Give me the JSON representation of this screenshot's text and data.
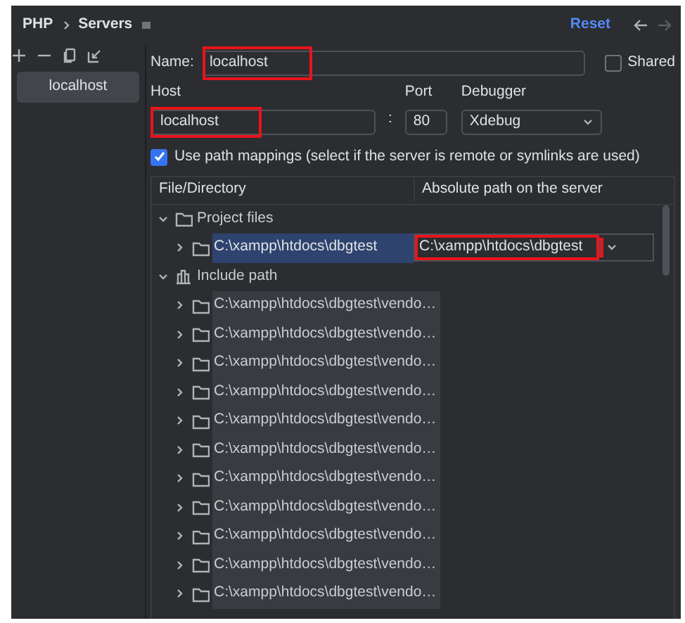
{
  "breadcrumb": [
    "PHP",
    "Servers"
  ],
  "header_actions": {
    "reset": "Reset"
  },
  "servers": [
    {
      "name": "localhost",
      "selected": true
    }
  ],
  "name_field": {
    "label": "Name:",
    "value": "localhost",
    "highlighted": true
  },
  "shared": {
    "label": "Shared",
    "checked": false
  },
  "host": {
    "label": "Host",
    "value": "localhost",
    "highlighted": true
  },
  "port_separator": ":",
  "port": {
    "label": "Port",
    "value": "80"
  },
  "debugger": {
    "label": "Debugger",
    "value": "Xdebug"
  },
  "use_path_mappings": {
    "label": "Use path mappings (select if the server is remote or symlinks are used)",
    "checked": true
  },
  "mappings": {
    "columns": [
      "File/Directory",
      "Absolute path on the server"
    ],
    "tree": [
      {
        "kind": "folder",
        "label": "Project files",
        "expanded": true,
        "children": [
          {
            "kind": "folder",
            "label": "C:\\xampp\\htdocs\\dbgtest",
            "expanded": false,
            "selected": true,
            "server_path": "C:\\xampp\\htdocs\\dbgtest",
            "highlighted": true
          }
        ]
      },
      {
        "kind": "library",
        "label": "Include path",
        "expanded": true,
        "children": [
          {
            "kind": "folder",
            "label": "C:\\xampp\\htdocs\\dbgtest\\vendo…",
            "expanded": false,
            "selected": false
          },
          {
            "kind": "folder",
            "label": "C:\\xampp\\htdocs\\dbgtest\\vendo…",
            "expanded": false,
            "selected": false
          },
          {
            "kind": "folder",
            "label": "C:\\xampp\\htdocs\\dbgtest\\vendo…",
            "expanded": false,
            "selected": false
          },
          {
            "kind": "folder",
            "label": "C:\\xampp\\htdocs\\dbgtest\\vendo…",
            "expanded": false,
            "selected": false
          },
          {
            "kind": "folder",
            "label": "C:\\xampp\\htdocs\\dbgtest\\vendo…",
            "expanded": false,
            "selected": false
          },
          {
            "kind": "folder",
            "label": "C:\\xampp\\htdocs\\dbgtest\\vendo…",
            "expanded": false,
            "selected": false
          },
          {
            "kind": "folder",
            "label": "C:\\xampp\\htdocs\\dbgtest\\vendo…",
            "expanded": false,
            "selected": false
          },
          {
            "kind": "folder",
            "label": "C:\\xampp\\htdocs\\dbgtest\\vendo…",
            "expanded": false,
            "selected": false
          },
          {
            "kind": "folder",
            "label": "C:\\xampp\\htdocs\\dbgtest\\vendo…",
            "expanded": false,
            "selected": false
          },
          {
            "kind": "folder",
            "label": "C:\\xampp\\htdocs\\dbgtest\\vendo…",
            "expanded": false,
            "selected": false
          },
          {
            "kind": "folder",
            "label": "C:\\xampp\\htdocs\\dbgtest\\vendo…",
            "expanded": false,
            "selected": false
          }
        ]
      }
    ]
  }
}
